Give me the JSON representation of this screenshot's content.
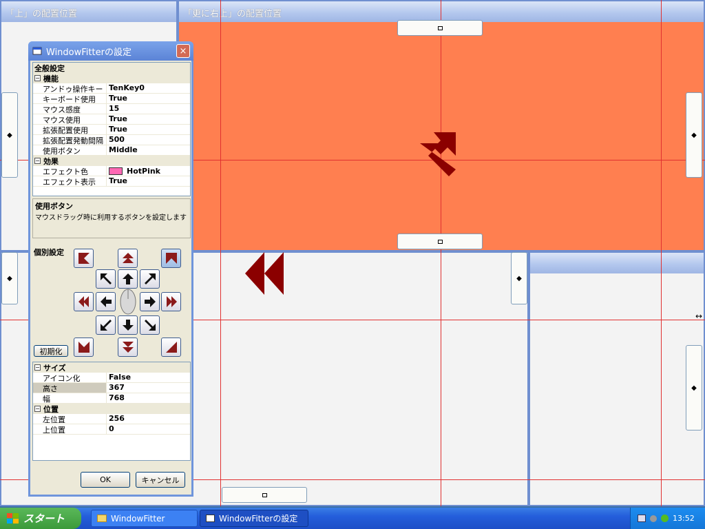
{
  "zones": {
    "left_title": "「上」の配置位置",
    "right_title": "「更に右上」の配置位置"
  },
  "dialog": {
    "title": "WindowFitterの設定",
    "close_icon": "×",
    "global_header": "全般設定",
    "categories": {
      "function": "機能",
      "effect": "効果",
      "size": "サイズ",
      "position": "位置"
    },
    "function_rows": [
      {
        "key": "アンドゥ操作キー",
        "value": "TenKey0"
      },
      {
        "key": "キーボード使用",
        "value": "True"
      },
      {
        "key": "マウス感度",
        "value": "15"
      },
      {
        "key": "マウス使用",
        "value": "True"
      },
      {
        "key": "拡張配置使用",
        "value": "True"
      },
      {
        "key": "拡張配置発動間隔",
        "value": "500"
      },
      {
        "key": "使用ボタン",
        "value": "Middle"
      }
    ],
    "effect_rows": [
      {
        "key": "エフェクト色",
        "value": "HotPink"
      },
      {
        "key": "エフェクト表示",
        "value": "True"
      }
    ],
    "help_title": "使用ボタン",
    "help_text": "マウスドラッグ時に利用するボタンを設定します",
    "individual_header": "個別設定",
    "reset_label": "初期化",
    "size_rows": [
      {
        "key": "アイコン化",
        "value": "False"
      },
      {
        "key": "高さ",
        "value": "367"
      },
      {
        "key": "幅",
        "value": "768"
      }
    ],
    "position_rows": [
      {
        "key": "左位置",
        "value": "256"
      },
      {
        "key": "上位置",
        "value": "0"
      }
    ],
    "ok_label": "OK",
    "cancel_label": "キャンセル",
    "swatch_color": "#ff69b4"
  },
  "taskbar": {
    "start_label": "スタート",
    "task1": "WindowFitter",
    "task2": "WindowFitterの設定",
    "clock": "13:52"
  },
  "colors": {
    "highlight_zone": "#ff7f50",
    "arrow_dark": "#8b0000"
  }
}
